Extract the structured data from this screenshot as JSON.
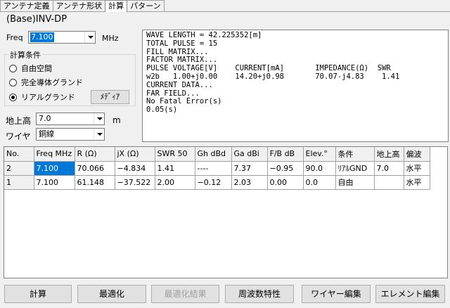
{
  "tabs": [
    "アンテナ定義",
    "アンテナ形状",
    "計算",
    "パターン"
  ],
  "active_tab": 2,
  "page_title": "(Base)INV-DP",
  "freq": {
    "label": "Freq",
    "value": "7.100",
    "unit": "MHz"
  },
  "calc_condition": {
    "label": "計算条件",
    "options": [
      "自由空間",
      "完全導体グランド",
      "リアルグランド"
    ],
    "selected": 2,
    "media_button": "ﾒﾃﾞｨｱ"
  },
  "height": {
    "label": "地上高",
    "value": "7.0",
    "unit": "m"
  },
  "wire": {
    "label": "ワイヤ",
    "value": "銅線"
  },
  "output_lines": [
    "WAVE LENGTH = 42.225352[m]",
    "TOTAL PULSE = 15",
    "FILL MATRIX...",
    "FACTOR MATRIX...",
    "PULSE VOLTAGE[V]    CURRENT[mA]       IMPEDANCE(Ω)  SWR",
    "w2b   1.00+j0.00    14.20+j0.98       70.07-j4.83    1.41",
    "CURRENT DATA...",
    "FAR FIELD...",
    "No Fatal Error(s)",
    "0.05(s)"
  ],
  "table": {
    "columns": [
      "No.",
      "Freq MHz",
      "R (Ω)",
      "jX (Ω)",
      "SWR 50",
      "Gh dBd",
      "Ga dBi",
      "F/B dB",
      "Elev.°",
      "条件",
      "地上高",
      "偏波"
    ],
    "rows": [
      [
        "2",
        "7.100",
        "70.066",
        "−4.834",
        "1.41",
        "----",
        "7.37",
        "−0.95",
        "90.0",
        "ﾘｱﾙGND",
        "7.0",
        "水平"
      ],
      [
        "1",
        "7.100",
        "61.148",
        "−37.522",
        "2.00",
        "−0.12",
        "2.03",
        "0.00",
        "0.0",
        "自由",
        "",
        "水平"
      ]
    ]
  },
  "buttons": {
    "calc": "計算",
    "optimize": "最適化",
    "optimize_result": "最適化結果",
    "freq_char": "周波数特性",
    "wire_edit": "ワイヤー編集",
    "element_edit": "エレメント編集"
  }
}
